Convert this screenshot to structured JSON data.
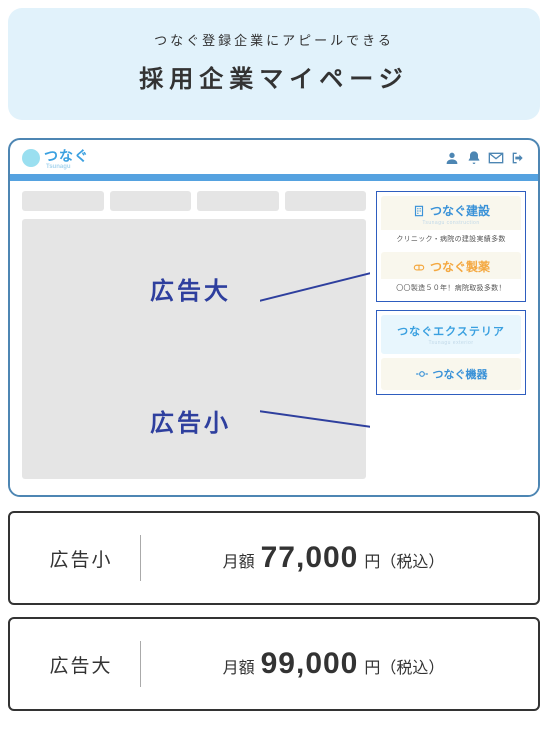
{
  "banner": {
    "sub": "つなぐ登録企業にアピールできる",
    "title": "採用企業マイページ"
  },
  "brand": {
    "name": "つなぐ",
    "sub": "Tsunagu"
  },
  "overlay": {
    "large_label": "広告大",
    "small_label": "広告小"
  },
  "ads": {
    "construction": {
      "title": "つなぐ建設",
      "sub": "Tsunagu construction",
      "tagline": "クリニック・病院の建設実績多数"
    },
    "pharma": {
      "title": "つなぐ製薬",
      "tagline": "〇〇製造５０年！病院取扱多数！"
    },
    "exterior": {
      "title": "つなぐエクステリア",
      "sub": "Tsunagu exterior"
    },
    "kiki": {
      "title": "つなぐ機器"
    }
  },
  "pricing": [
    {
      "name": "広告小",
      "label": "月額",
      "amount": "77,000",
      "unit": "円（税込）"
    },
    {
      "name": "広告大",
      "label": "月額",
      "amount": "99,000",
      "unit": "円（税込）"
    }
  ]
}
